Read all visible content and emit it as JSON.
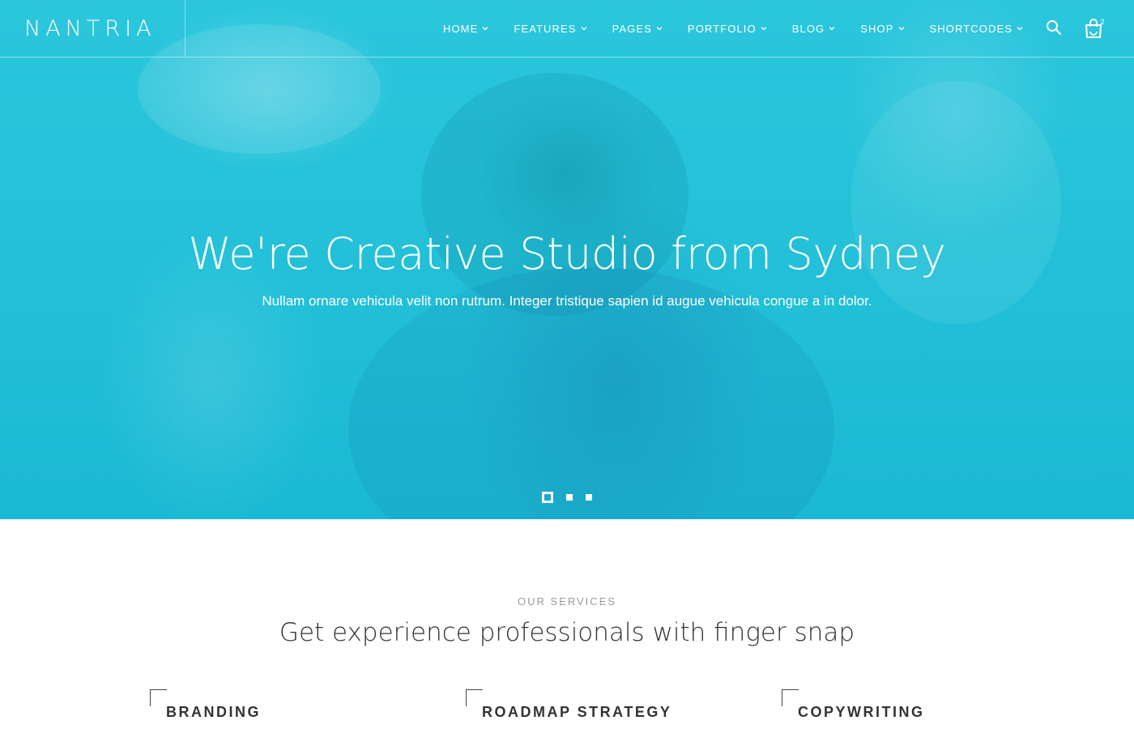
{
  "brand": {
    "logo": "NANTRIA",
    "accent": "#22c0d8"
  },
  "nav": {
    "items": [
      {
        "label": "HOME"
      },
      {
        "label": "FEATURES"
      },
      {
        "label": "PAGES"
      },
      {
        "label": "PORTFOLIO"
      },
      {
        "label": "BLOG"
      },
      {
        "label": "SHOP"
      },
      {
        "label": "SHORTCODES"
      }
    ],
    "search_icon": "search-icon",
    "cart_icon": "shopping-bag-icon",
    "cart_count": "2"
  },
  "hero": {
    "title": "We're Creative Studio from Sydney",
    "subtitle": "Nullam ornare vehicula velit non rutrum. Integer tristique sapien id augue vehicula congue a in dolor.",
    "slides": 3,
    "active_slide": 1
  },
  "services": {
    "eyebrow": "OUR SERVICES",
    "title": "Get experience professionals with finger snap",
    "items": [
      {
        "label": "BRANDING"
      },
      {
        "label": "ROADMAP STRATEGY"
      },
      {
        "label": "COPYWRITING"
      }
    ]
  }
}
